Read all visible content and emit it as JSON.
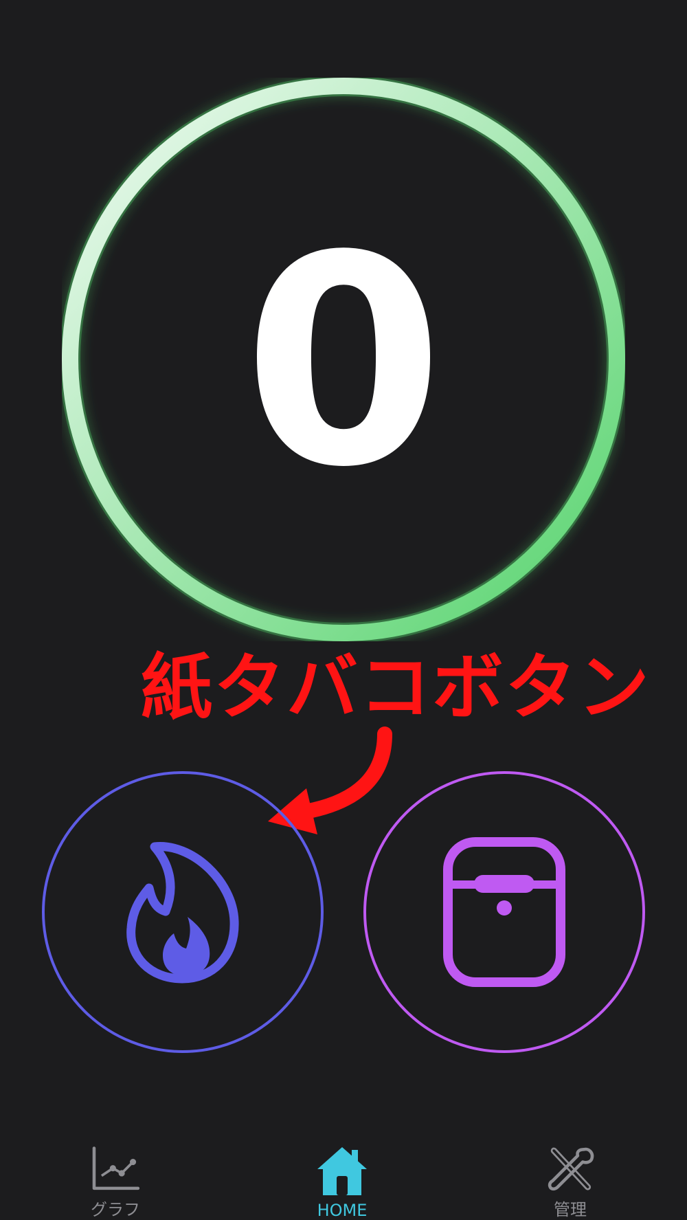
{
  "counter": {
    "value": "0",
    "ring_color_start": "#e9f8ec",
    "ring_color_end": "#5ed874"
  },
  "annotation": {
    "label": "紙タバコボタン",
    "color": "#ff1414"
  },
  "buttons": {
    "cigarette": {
      "icon": "flame-icon",
      "color": "#5e5ce6"
    },
    "heated": {
      "icon": "heated-tobacco-device-icon",
      "color": "#bf5af2"
    }
  },
  "tabbar": {
    "items": [
      {
        "label": "グラフ",
        "icon": "line-chart-icon",
        "active": false
      },
      {
        "label": "HOME",
        "icon": "house-icon",
        "active": true
      },
      {
        "label": "管理",
        "icon": "tools-icon",
        "active": false
      }
    ],
    "active_color": "#40c8e0",
    "inactive_color": "#8e8e93"
  }
}
